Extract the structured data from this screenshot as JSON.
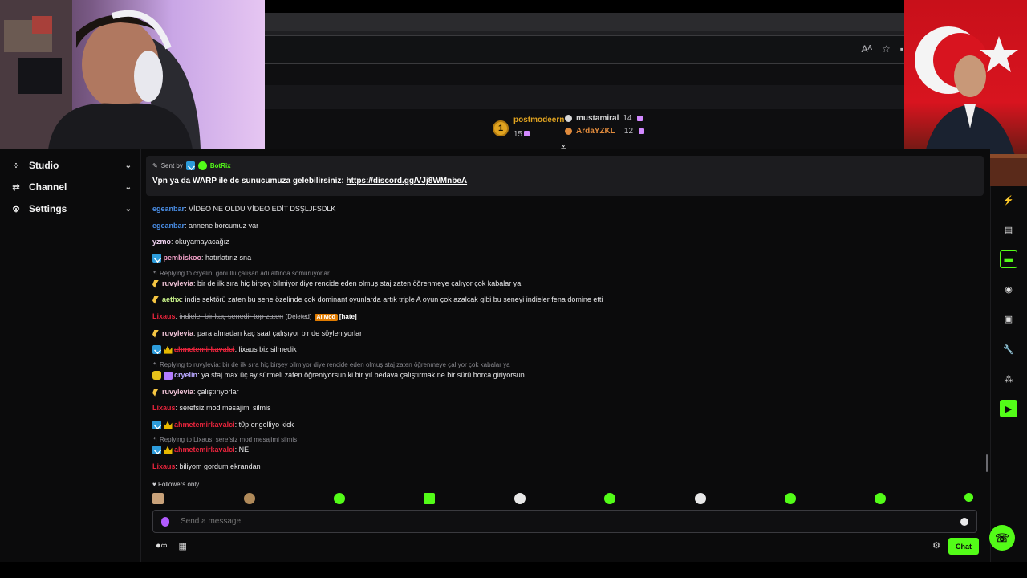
{
  "podium": {
    "first": {
      "rank": "1",
      "name": "postmodeern",
      "count": "15",
      "color": "#e0a320"
    },
    "second": {
      "name": "mustamiral",
      "count": "14",
      "color": "#d8d8d8"
    },
    "third": {
      "name": "ArdaYZKL",
      "count": "12",
      "color": "#e08a3c"
    }
  },
  "sidebar": {
    "items": [
      {
        "label": "Studio",
        "icon": "studio-icon"
      },
      {
        "label": "Channel",
        "icon": "channel-icon"
      },
      {
        "label": "Settings",
        "icon": "gear-icon"
      }
    ]
  },
  "pinned": {
    "sent_by": "Sent by",
    "sender": "BotRix",
    "message": "Vpn ya da WARP ile dc sunucumuza gelebilirsiniz:",
    "link": "https://discord.gg/VJj8WMnbeA"
  },
  "messages": [
    {
      "user": "egeanbar",
      "text": "VİDEO NE OLDU VİDEO EDİT DSŞLJFSDLK",
      "color": "#4a8fe8"
    },
    {
      "user": "egeanbar",
      "text": "annene borcumuz var",
      "color": "#4a8fe8"
    },
    {
      "user": "yzmo",
      "text": "okuyamayacağız",
      "color": "#f2d4f2"
    },
    {
      "user": "pembiskoo",
      "text": "hatırlatırız sna",
      "color": "#f2a0c8"
    },
    {
      "reply": "Replying to cryelin: gönüllü çalışan adı altında sömürüyorlar"
    },
    {
      "user": "ruvylevia",
      "text": "bir de ilk sıra hiç birşey bilmiyor diye rencide eden olmuş staj zaten öğrenmeye çalıyor çok kabalar ya",
      "color": "#f2c4d8"
    },
    {
      "user": "aethx",
      "text": "indie sektörü zaten bu sene özelinde çok dominant oyunlarda artık triple A oyun çok azalcak gibi bu seneyi indieler fena domine etti",
      "color": "#c8f28a"
    },
    {
      "user": "Lixaus",
      "text": "indieler bir kaç senedir top zaten",
      "deleted": "(Deleted)",
      "aimod": "AI Mod",
      "hate": "[hate]",
      "color": "#e8243c"
    },
    {
      "user": "ruvylevia",
      "text": "para almadan kaç saat çalışıyor bir de söyleniyorlar",
      "color": "#f2c4d8"
    },
    {
      "user": "ahmetemirkavalci",
      "text": "lixaus biz silmedik",
      "color": "#e8243c"
    },
    {
      "reply": "Replying to ruvylevia: bir de ilk sıra hiç birşey bilmiyor diye rencide eden olmuş staj zaten öğrenmeye çalıyor çok kabalar ya"
    },
    {
      "user": "cryelin",
      "text": "ya staj max üç ay sürmeli zaten öğreniyorsun ki bir yıl bedava çalıştırmak ne bir sürü borca giriyorsun",
      "color": "#b8a8ff"
    },
    {
      "user": "ruvylevia",
      "text": "çalıştırıyorlar",
      "color": "#f2c4d8"
    },
    {
      "user": "Lixaus",
      "text": "serefsiz mod mesajimi silmis",
      "color": "#e8243c"
    },
    {
      "user": "ahmetemirkavalci",
      "text": "t0p engelliyo kick",
      "color": "#e8243c"
    },
    {
      "reply": "Replying to Lixaus: serefsiz mod mesajimi silmis"
    },
    {
      "user": "ahmetemirkavalci",
      "text": "NE",
      "color": "#e8243c"
    },
    {
      "user": "Lixaus",
      "text": "biliyom gordum ekrandan",
      "color": "#e8243c"
    }
  ],
  "followers_only": "Followers only",
  "input": {
    "placeholder": "Send a message"
  },
  "chat_button": "Chat",
  "colors": {
    "accent": "#53fc18",
    "background": "#0b0b0c"
  }
}
